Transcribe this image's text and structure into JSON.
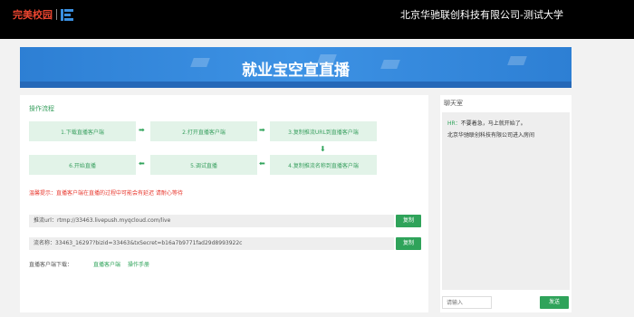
{
  "header": {
    "logo_text": "完美校园",
    "org_title": "北京华驰联创科技有限公司-测试大学"
  },
  "banner": {
    "title": "就业宝空宣直播"
  },
  "process": {
    "title": "操作流程",
    "steps": [
      "1.下载直播客户端",
      "2.打开直播客户端",
      "3.复制推流URL到直播客户端",
      "4.复制推流名称到直播客户端",
      "5.调试直播",
      "6.开始直播"
    ]
  },
  "tip": "温馨提示：直播客户端在直播的过程中可能会有延迟 请耐心等待",
  "stream_url": {
    "label": "推流url：",
    "value": "rtmp://33463.livepush.myqcloud.com/live",
    "copy_label": "复制"
  },
  "stream_name": {
    "label": "流名称：",
    "value": "33463_16297?bizid=33463&txSecret=b16a7b9771fad29d8993922c",
    "copy_label": "复制"
  },
  "downloads": {
    "label": "直播客户端下载：",
    "client_link": "直播客户端",
    "manual_link": "操作手册"
  },
  "chat": {
    "title": "聊天室",
    "messages": [
      {
        "sender": "HR：",
        "text": "不要着急，马上就开始了。"
      },
      {
        "sender": "",
        "text": "北京华驰联创科技有限公司进入房间"
      }
    ],
    "input_placeholder": "请输入",
    "send_label": "发送"
  },
  "colors": {
    "accent": "#2fa35a",
    "banner": "#3d92e4",
    "warning": "#e8392f"
  },
  "icons": {
    "step_arrow": "arrow-right-icon",
    "step_arrow_left": "arrow-left-icon",
    "step_arrow_down": "arrow-down-icon"
  }
}
